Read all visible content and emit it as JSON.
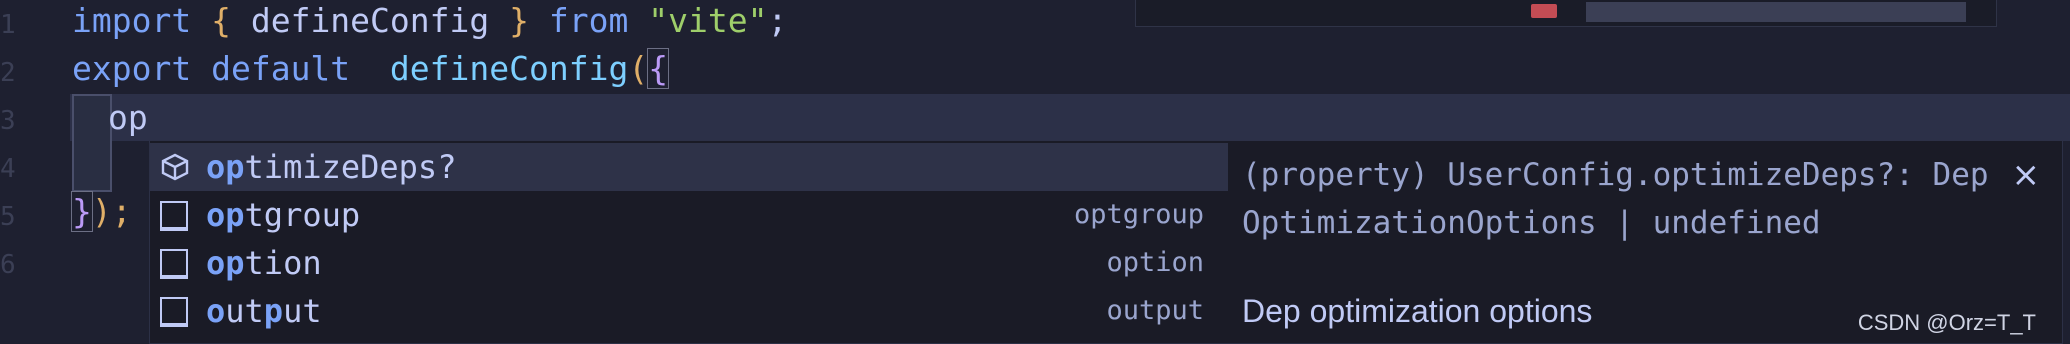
{
  "editor": {
    "line_numbers": [
      "1",
      "2",
      "3",
      "4",
      "5",
      "6"
    ],
    "line1": {
      "kw1": "import",
      "lbrace": "{",
      "ident": " defineConfig ",
      "rbrace": "}",
      "kw2": "from",
      "str": "\"vite\"",
      "semi": ";"
    },
    "line2": {
      "kw1": "export",
      "kw2": "default",
      "fn": "defineConfig",
      "lparen": "(",
      "lbrace": "{"
    },
    "line3": {
      "typed": "op"
    },
    "line4": {
      "rbrace": "}",
      "rest": ");"
    }
  },
  "suggest": {
    "items": [
      {
        "match": "op",
        "rest": "timizeDeps?",
        "detail": "",
        "icon": "property-cube-icon",
        "selected": true
      },
      {
        "match": "op",
        "rest": "tgroup",
        "detail": "optgroup",
        "icon": "snippet-box-icon"
      },
      {
        "match": "op",
        "rest": "tion",
        "detail": "option",
        "icon": "snippet-box-icon"
      },
      {
        "match1": "o",
        "mid": "ut",
        "match2": "p",
        "rest": "ut",
        "detail": "output",
        "icon": "snippet-box-icon"
      }
    ]
  },
  "details": {
    "signature": "(property) UserConfig.optimizeDeps?: DepOptimizationOptions | undefined",
    "close": "×",
    "doc": "Dep optimization options"
  },
  "watermark": "CSDN @Orz=T_T"
}
